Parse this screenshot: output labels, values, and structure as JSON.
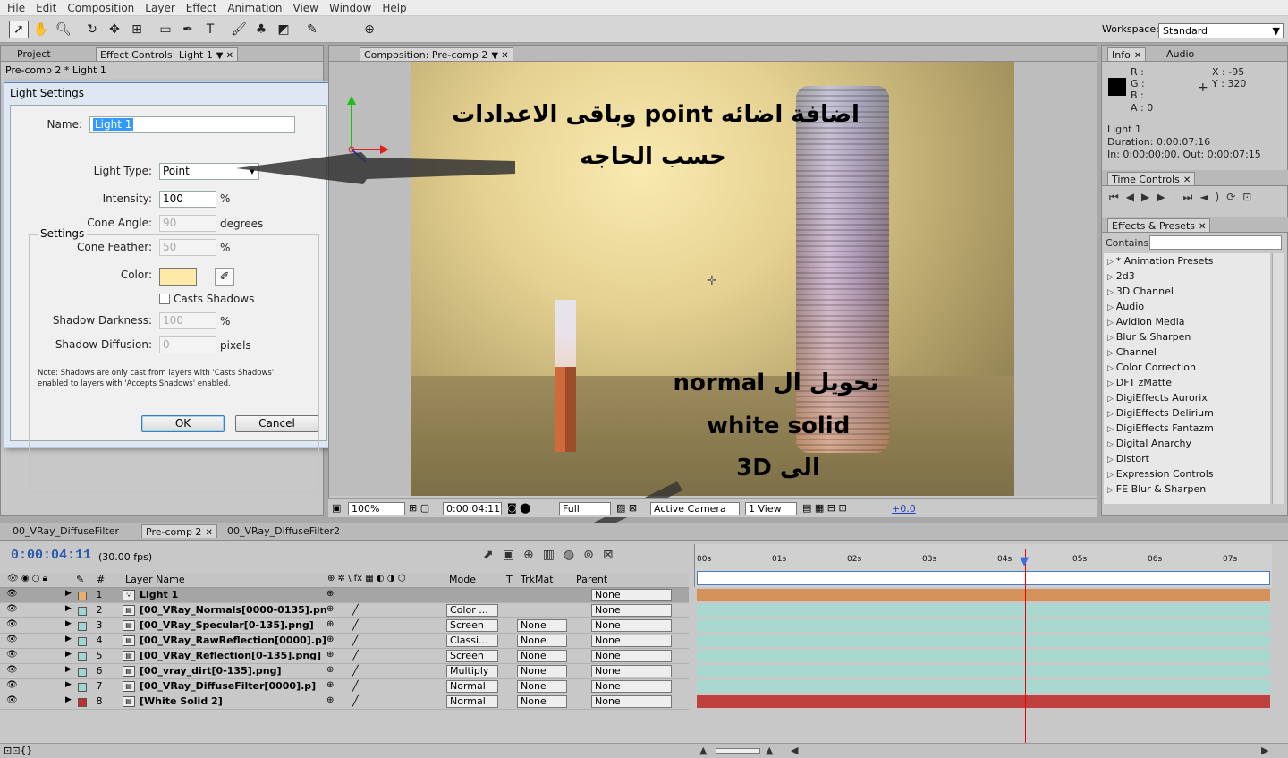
{
  "menu": [
    "File",
    "Edit",
    "Composition",
    "Layer",
    "Effect",
    "Animation",
    "View",
    "Window",
    "Help"
  ],
  "workspace": {
    "label": "Workspace:",
    "value": "Standard"
  },
  "left_panel": {
    "tabs": [
      "Project",
      "Effect Controls: Light 1"
    ],
    "breadcrumb": "Pre-comp 2 * Light 1"
  },
  "dialog": {
    "title": "Light Settings",
    "name_label": "Name:",
    "name_value": "Light 1",
    "settings_legend": "Settings",
    "light_type_label": "Light Type:",
    "light_type_value": "Point",
    "intensity_label": "Intensity:",
    "intensity_value": "100",
    "intensity_unit": "%",
    "cone_angle_label": "Cone Angle:",
    "cone_angle_value": "90",
    "cone_angle_unit": "degrees",
    "cone_feather_label": "Cone Feather:",
    "cone_feather_value": "50",
    "cone_feather_unit": "%",
    "color_label": "Color:",
    "color_value": "#fde9a8",
    "casts_shadows_label": "Casts Shadows",
    "shadow_darkness_label": "Shadow Darkness:",
    "shadow_darkness_value": "100",
    "shadow_darkness_unit": "%",
    "shadow_diffusion_label": "Shadow Diffusion:",
    "shadow_diffusion_value": "0",
    "shadow_diffusion_unit": "pixels",
    "note": "Note: Shadows are only cast from layers with 'Casts Shadows' enabled to layers with 'Accepts Shadows' enabled.",
    "ok_label": "OK",
    "cancel_label": "Cancel"
  },
  "composition": {
    "tab": "Composition: Pre-comp 2",
    "zoom": "100%",
    "timecode": "0:00:04:11",
    "resolution": "Full",
    "camera": "Active Camera",
    "view": "1 View",
    "exposure": "+0.0"
  },
  "annotations": {
    "line1": "اضافة اضائه point وباقى الاعدادات",
    "line2": "حسب الحاجه",
    "normal": "تحويل ال normal",
    "white": "white solid",
    "to3d": "الى 3D"
  },
  "info": {
    "tabs": [
      "Info",
      "Audio"
    ],
    "r": "R :",
    "g": "G :",
    "b": "B :",
    "a": "A : 0",
    "x": "X : -95",
    "y": "Y : 320",
    "layer": "Light 1",
    "duration": "Duration: 0:00:07:16",
    "inout": "In: 0:00:00:00, Out: 0:00:07:15"
  },
  "time_controls": {
    "tab": "Time Controls"
  },
  "effects": {
    "tab": "Effects & Presets",
    "contains_label": "Contains:",
    "items": [
      "* Animation Presets",
      "2d3",
      "3D Channel",
      "Audio",
      "Avidion Media",
      "Blur & Sharpen",
      "Channel",
      "Color Correction",
      "DFT zMatte",
      "DigiEffects Aurorix",
      "DigiEffects Delirium",
      "DigiEffects Fantazm",
      "Digital Anarchy",
      "Distort",
      "Expression Controls",
      "FE Blur & Sharpen"
    ]
  },
  "timeline": {
    "tabs": [
      "00_VRay_DiffuseFilter",
      "Pre-comp 2",
      "00_VRay_DiffuseFilter2"
    ],
    "timecode": "0:00:04:11",
    "fps": "(30.00 fps)",
    "headers": {
      "num": "#",
      "name": "Layer Name",
      "mode": "Mode",
      "t": "T",
      "trkmat": "TrkMat",
      "parent": "Parent"
    },
    "ruler": [
      "00s",
      "01s",
      "02s",
      "03s",
      "04s",
      "05s",
      "06s",
      "07s"
    ],
    "cti_seconds": 4.37,
    "duration_seconds": 7.53,
    "layers": [
      {
        "num": "1",
        "name": "Light 1",
        "color": "#e8b070",
        "mode": "",
        "trk": "",
        "parent": "None",
        "bar": "#d4915a",
        "sel": true
      },
      {
        "num": "2",
        "name": "[00_VRay_Normals[0000-0135].pn",
        "color": "#9fd6d1",
        "mode": "Color ...",
        "trk": "",
        "parent": "None",
        "bar": "#a9d8d1"
      },
      {
        "num": "3",
        "name": "[00_VRay_Specular[0-135].png]",
        "color": "#9fd6d1",
        "mode": "Screen",
        "trk": "None",
        "parent": "None",
        "bar": "#a9d8d1"
      },
      {
        "num": "4",
        "name": "[00_VRay_RawReflection[0000].p]",
        "color": "#9fd6d1",
        "mode": "Classi...",
        "trk": "None",
        "parent": "None",
        "bar": "#a9d8d1"
      },
      {
        "num": "5",
        "name": "[00_VRay_Reflection[0-135].png]",
        "color": "#9fd6d1",
        "mode": "Screen",
        "trk": "None",
        "parent": "None",
        "bar": "#a9d8d1"
      },
      {
        "num": "6",
        "name": "[00_vray_dirt[0-135].png]",
        "color": "#9fd6d1",
        "mode": "Multiply",
        "trk": "None",
        "parent": "None",
        "bar": "#a9d8d1"
      },
      {
        "num": "7",
        "name": "[00_VRay_DiffuseFilter[0000].p]",
        "color": "#9fd6d1",
        "mode": "Normal",
        "trk": "None",
        "parent": "None",
        "bar": "#a9d8d1"
      },
      {
        "num": "8",
        "name": "[White Solid 2]",
        "color": "#c03030",
        "mode": "Normal",
        "trk": "None",
        "parent": "None",
        "bar": "#c04040"
      }
    ]
  }
}
